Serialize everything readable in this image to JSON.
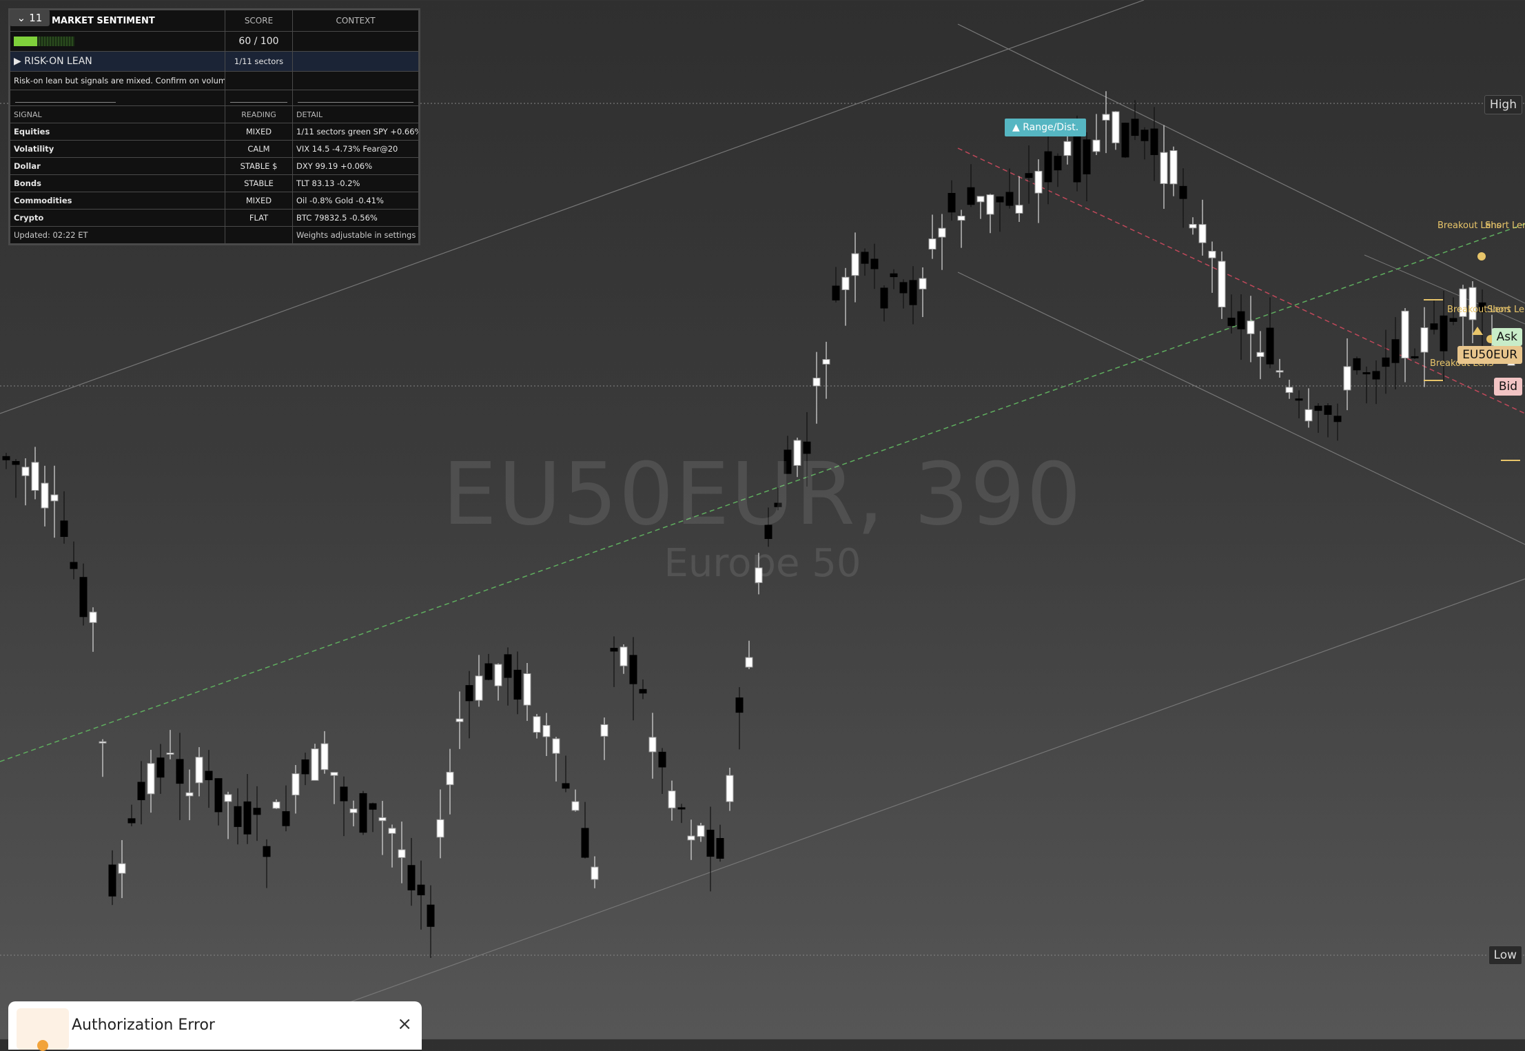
{
  "chart": {
    "symbol_watermark": "EU50EUR, 390",
    "name_watermark": "Europe 50",
    "high_label": "High",
    "low_label": "Low",
    "ask_label": "Ask",
    "symbol_label": "EU50EUR",
    "bid_label": "Bid",
    "range_dist_label": "▲ Range/Dist.",
    "breakout_labels": [
      "Breakout Lens",
      "Short Lens",
      "Breakout Lens",
      "Short Lens",
      "Breakout Lens"
    ],
    "colors": {
      "bull": "#ffffff",
      "bear": "#000000",
      "range_tag": "#56b6c2",
      "trend_up": "#5fae5f",
      "trend_down": "#c0485a",
      "lens": "#e8c56a"
    }
  },
  "panel": {
    "collapse_label": "11",
    "title": "MARKET SENTIMENT",
    "col_score": "SCORE",
    "col_context": "CONTEXT",
    "score_text": "60 / 100",
    "score_fraction": 0.6,
    "lean_text": "▶ RISK-ON LEAN",
    "lean_sectors": "1/11 sectors",
    "note": "Risk-on lean but signals are mixed. Confirm on volume.",
    "label_signal": "SIGNAL",
    "label_reading": "READING",
    "label_detail": "DETAIL",
    "signals": [
      {
        "name": "Equities",
        "reading": "MIXED",
        "detail": "1/11 sectors green  SPY +0.66%"
      },
      {
        "name": "Volatility",
        "reading": "CALM",
        "detail": "VIX 14.5  -4.73%  Fear@20"
      },
      {
        "name": "Dollar",
        "reading": "STABLE $",
        "detail": "DXY 99.19  +0.06%"
      },
      {
        "name": "Bonds",
        "reading": "STABLE",
        "detail": "TLT 83.13  -0.2%"
      },
      {
        "name": "Commodities",
        "reading": "MIXED",
        "detail": "Oil -0.8%  Gold -0.41%"
      },
      {
        "name": "Crypto",
        "reading": "FLAT",
        "detail": "BTC 79832.5  -0.56%"
      }
    ],
    "updated": "Updated: 02:22 ET",
    "weights_note": "Weights adjustable in settings"
  },
  "toast": {
    "title": "Authorization Error",
    "close": "×"
  }
}
